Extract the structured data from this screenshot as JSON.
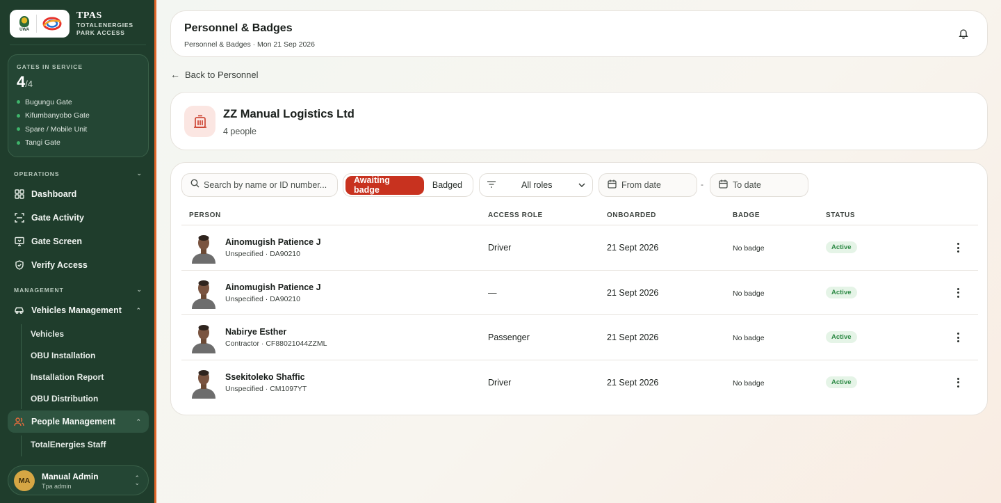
{
  "brand": {
    "title": "TPAS",
    "subtitle_line1": "TOTALENERGIES",
    "subtitle_line2": "PARK ACCESS",
    "uwa_text": "UWA"
  },
  "gates": {
    "label": "GATES IN SERVICE",
    "count": "4",
    "total": "/4",
    "items": [
      "Bugungu Gate",
      "Kifumbanyobo Gate",
      "Spare / Mobile Unit",
      "Tangi Gate"
    ]
  },
  "nav": {
    "operations_label": "OPERATIONS",
    "operations": [
      {
        "label": "Dashboard",
        "icon": "grid-icon"
      },
      {
        "label": "Gate Activity",
        "icon": "scan-icon"
      },
      {
        "label": "Gate Screen",
        "icon": "monitor-icon"
      },
      {
        "label": "Verify Access",
        "icon": "shield-check-icon"
      }
    ],
    "management_label": "MANAGEMENT",
    "vehicles_label": "Vehicles Management",
    "vehicles_sub": [
      "Vehicles",
      "OBU Installation",
      "Installation Report",
      "OBU Distribution"
    ],
    "people_label": "People Management",
    "people_sub": [
      "TotalEnergies Staff"
    ]
  },
  "user": {
    "initials": "MA",
    "name": "Manual Admin",
    "role": "Tpa admin"
  },
  "header": {
    "title": "Personnel & Badges",
    "subtitle": "Personnel & Badges · Mon 21 Sep 2026"
  },
  "back_label": "Back to Personnel",
  "company": {
    "name": "ZZ Manual Logistics Ltd",
    "count": "4 people"
  },
  "filters": {
    "search_placeholder": "Search by name or ID number...",
    "seg_awaiting": "Awaiting badge",
    "seg_badged": "Badged",
    "roles_value": "All roles",
    "from_date": "From date",
    "to_date": "To date",
    "separator": "-"
  },
  "table": {
    "headers": {
      "person": "PERSON",
      "role": "ACCESS ROLE",
      "onboarded": "ONBOARDED",
      "badge": "BADGE",
      "status": "STATUS"
    },
    "rows": [
      {
        "name": "Ainomugish Patience J",
        "meta": "Unspecified · DA90210",
        "role": "Driver",
        "onboarded": "21 Sept 2026",
        "badge": "No badge",
        "status": "Active"
      },
      {
        "name": "Ainomugish Patience J",
        "meta": "Unspecified · DA90210",
        "role": "—",
        "onboarded": "21 Sept 2026",
        "badge": "No badge",
        "status": "Active"
      },
      {
        "name": "Nabirye Esther",
        "meta": "Contractor · CF88021044ZZML",
        "role": "Passenger",
        "onboarded": "21 Sept 2026",
        "badge": "No badge",
        "status": "Active"
      },
      {
        "name": "Ssekitoleko Shaffic",
        "meta": "Unspecified · CM1097YT",
        "role": "Driver",
        "onboarded": "21 Sept 2026",
        "badge": "No badge",
        "status": "Active"
      }
    ]
  },
  "colors": {
    "sidebar": "#1f3d2c",
    "accent": "#c8321f",
    "status_active": "#2e8a46"
  }
}
